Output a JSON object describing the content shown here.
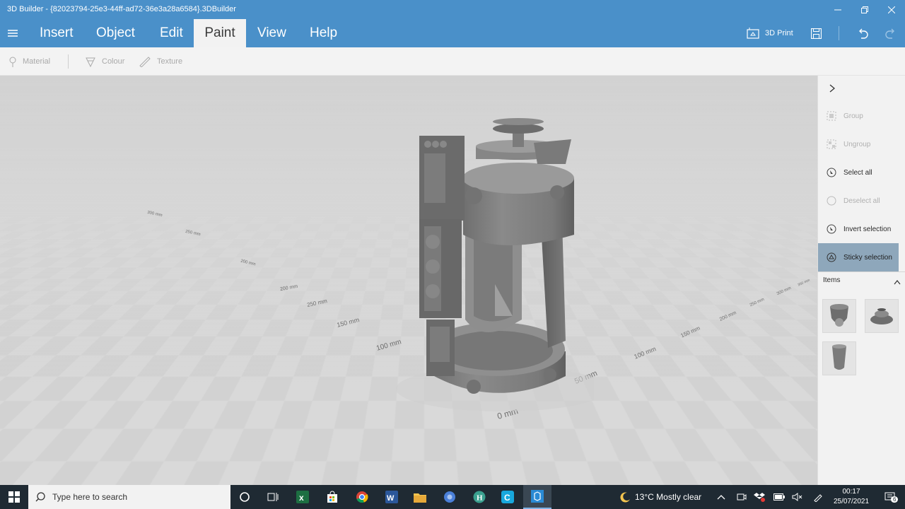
{
  "window": {
    "title": "3D Builder - {82023794-25e3-44ff-ad72-36e3a28a6584}.3DBuilder"
  },
  "menu": {
    "tabs": [
      {
        "label": "Insert"
      },
      {
        "label": "Object"
      },
      {
        "label": "Edit"
      },
      {
        "label": "Paint"
      },
      {
        "label": "View"
      },
      {
        "label": "Help"
      }
    ],
    "active_tab": "Paint",
    "print_label": "3D Print"
  },
  "toolbar": {
    "material_label": "Material",
    "colour_label": "Colour",
    "texture_label": "Texture"
  },
  "viewport": {
    "ruler_labels": [
      "300 mm",
      "250 mm",
      "200 mm",
      "150 mm",
      "100 mm",
      "50 mm",
      "0 mm",
      "50 mm",
      "100 mm",
      "150 mm",
      "200 mm",
      "250 mm",
      "300 mm",
      "350 mm"
    ]
  },
  "side_panel": {
    "group_label": "Group",
    "ungroup_label": "Ungroup",
    "select_all_label": "Select all",
    "deselect_all_label": "Deselect all",
    "invert_selection_label": "Invert selection",
    "sticky_selection_label": "Sticky selection",
    "items_label": "Items"
  },
  "taskbar": {
    "search_placeholder": "Type here to search",
    "weather": "13°C  Mostly clear",
    "time": "00:17",
    "date": "25/07/2021",
    "notification_count": "6"
  },
  "colors": {
    "accent": "#4a90c9",
    "selected": "#8ea7bb",
    "taskbar": "#1f2a33"
  }
}
